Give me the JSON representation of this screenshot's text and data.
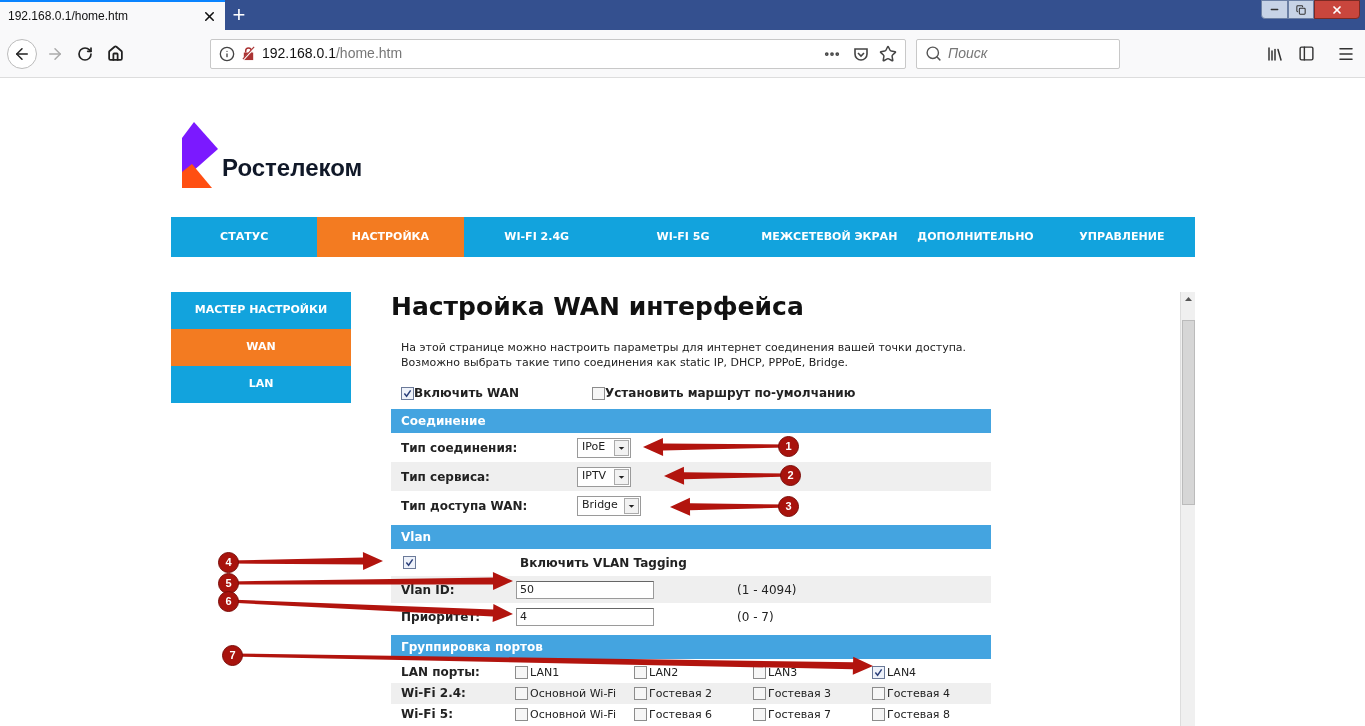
{
  "browser": {
    "tabs": [
      {
        "title": "192.168.0.1/home.htm",
        "selected": true
      }
    ],
    "new_tab": "+",
    "address": {
      "host": "192.168.0.1",
      "path": "/home.htm"
    },
    "search": {
      "placeholder": "Поиск"
    }
  },
  "logo": "Ростелеком",
  "nav": [
    {
      "label": "СТАТУС",
      "selected": false
    },
    {
      "label": "НАСТРОЙКА",
      "selected": true
    },
    {
      "label": "WI-FI 2.4G",
      "selected": false
    },
    {
      "label": "WI-FI 5G",
      "selected": false
    },
    {
      "label": "МЕЖСЕТЕВОЙ ЭКРАН",
      "selected": false
    },
    {
      "label": "ДОПОЛНИТЕЛЬНО",
      "selected": false
    },
    {
      "label": "УПРАВЛЕНИЕ",
      "selected": false
    }
  ],
  "sidebar": [
    {
      "label": "МАСТЕР НАСТРОЙКИ",
      "selected": false
    },
    {
      "label": "WAN",
      "selected": true
    },
    {
      "label": "LAN",
      "selected": false
    }
  ],
  "title": "Настройка WAN интерфейса",
  "description": [
    "На этой странице можно настроить параметры для интернет соединения вашей точки доступа.",
    "Возможно выбрать такие типо соединения как static IP, DHCP, PPPoE, Bridge."
  ],
  "options": [
    {
      "label": "Включить WAN",
      "checked": true
    },
    {
      "label": "Установить маршрут по-умолчанию",
      "checked": false
    }
  ],
  "sections": [
    {
      "title": "Соединение",
      "rows": [
        {
          "kind": "select",
          "label": "Тип соединения:",
          "value": "IPoE"
        },
        {
          "kind": "select",
          "label": "Тип сервиса:",
          "value": "IPTV"
        },
        {
          "kind": "select",
          "label": "Тип доступа WAN:",
          "value": "Bridge"
        }
      ]
    },
    {
      "title": "Vlan",
      "rows": [
        {
          "kind": "checkbox",
          "label": "Включить VLAN Tagging",
          "checked": true
        },
        {
          "kind": "input",
          "label": "Vlan ID:",
          "value": "50",
          "hint": "(1 - 4094)"
        },
        {
          "kind": "input",
          "label": "Приоритет:",
          "value": "4",
          "hint": "(0 - 7)"
        }
      ]
    },
    {
      "title": "Группировка портов",
      "rows": [
        {
          "kind": "ports",
          "label": "LAN порты:",
          "items": [
            {
              "label": "LAN1",
              "checked": false
            },
            {
              "label": "LAN2",
              "checked": false
            },
            {
              "label": "LAN3",
              "checked": false
            },
            {
              "label": "LAN4",
              "checked": true
            }
          ]
        },
        {
          "kind": "ports",
          "label": "Wi-Fi 2.4:",
          "items": [
            {
              "label": "Основной Wi-Fi",
              "checked": false
            },
            {
              "label": "Гостевая 2",
              "checked": false
            },
            {
              "label": "Гостевая 3",
              "checked": false
            },
            {
              "label": "Гостевая 4",
              "checked": false
            }
          ]
        },
        {
          "kind": "ports",
          "label": "Wi-Fi 5:",
          "items": [
            {
              "label": "Основной Wi-Fi",
              "checked": false
            },
            {
              "label": "Гостевая 6",
              "checked": false
            },
            {
              "label": "Гостевая 7",
              "checked": false
            },
            {
              "label": "Гостевая 8",
              "checked": false
            }
          ]
        }
      ]
    }
  ],
  "annotations": [
    "1",
    "2",
    "3",
    "4",
    "5",
    "6",
    "7"
  ]
}
